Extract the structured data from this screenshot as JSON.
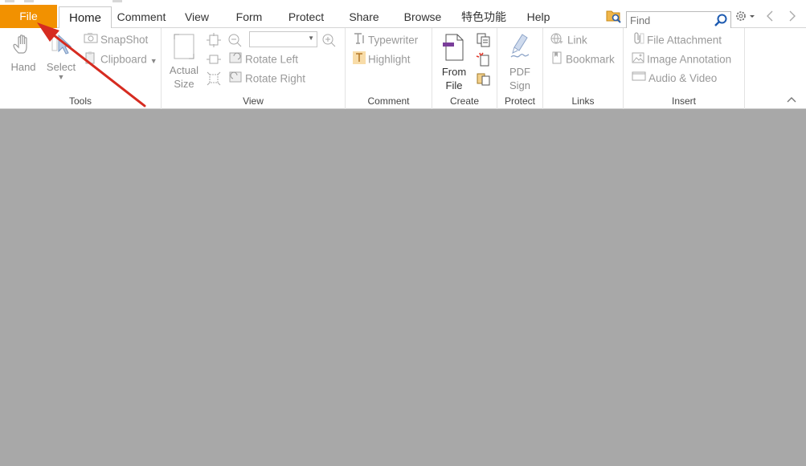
{
  "tabs": {
    "file": "File",
    "items": [
      "Home",
      "Comment",
      "View",
      "Form",
      "Protect",
      "Share",
      "Browse",
      "特色功能",
      "Help"
    ]
  },
  "search": {
    "placeholder": "Find"
  },
  "ribbon": {
    "tools": {
      "label": "Tools",
      "hand": "Hand",
      "select": "Select",
      "snapshot": "SnapShot",
      "clipboard": "Clipboard"
    },
    "view": {
      "label": "View",
      "actual_size_line1": "Actual",
      "actual_size_line2": "Size",
      "rotate_left": "Rotate Left",
      "rotate_right": "Rotate Right",
      "zoom_value": ""
    },
    "comment": {
      "label": "Comment",
      "typewriter": "Typewriter",
      "highlight": "Highlight"
    },
    "create": {
      "label": "Create",
      "from_file_line1": "From",
      "from_file_line2": "File"
    },
    "protect": {
      "label": "Protect",
      "pdf_sign_line1": "PDF",
      "pdf_sign_line2": "Sign"
    },
    "links": {
      "label": "Links",
      "link": "Link",
      "bookmark": "Bookmark"
    },
    "insert": {
      "label": "Insert",
      "file_attachment": "File Attachment",
      "image_annotation": "Image Annotation",
      "audio_video": "Audio & Video"
    }
  },
  "colors": {
    "file_tab": "#f29100",
    "document_area": "#a8a8a8",
    "annotation_arrow": "#d62b20",
    "create_accent": "#7a3d9a"
  }
}
